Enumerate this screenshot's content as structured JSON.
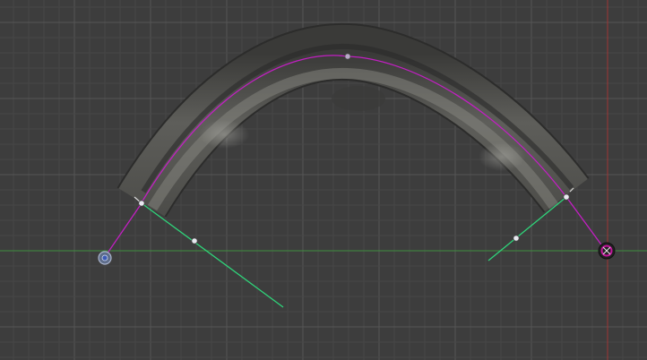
{
  "viewport": {
    "kind": "3D curve edit view",
    "background_color": "#3d3d3d",
    "grid_minor_color": "#474747",
    "grid_major_color": "#555555",
    "x_axis_color": "#3e8f3e",
    "y_axis_color": "#a03535"
  },
  "curve": {
    "tube_color": "#6b6b67",
    "tube_highlight": "#9a9a95",
    "spline_color": "#c21fc2",
    "handle_line_color": "#c21fc2",
    "aligned_handle_color": "#2fd47a",
    "control_point_color": "#e8e8f0"
  },
  "gizmos": {
    "origin_icon": "origin-circle-icon",
    "cursor_icon": "3d-cursor-icon",
    "cursor_color": "#c0159a"
  }
}
